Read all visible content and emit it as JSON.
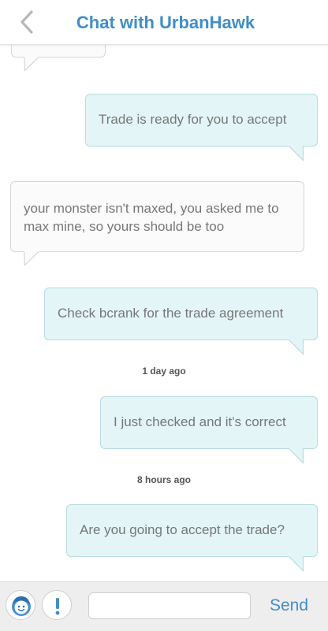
{
  "header": {
    "title": "Chat with UrbanHawk",
    "back_icon": "chevron-left-icon"
  },
  "messages": [
    {
      "kind": "bubble",
      "direction": "incoming",
      "text": ""
    },
    {
      "kind": "bubble",
      "direction": "outgoing",
      "text": "Trade is ready for you to accept"
    },
    {
      "kind": "bubble",
      "direction": "incoming",
      "text": "your monster isn't maxed, you asked me to max mine, so yours should be too"
    },
    {
      "kind": "bubble",
      "direction": "outgoing",
      "text": "Check bcrank for the trade agreement"
    },
    {
      "kind": "timestamp",
      "text": "1 day ago"
    },
    {
      "kind": "bubble",
      "direction": "outgoing",
      "text": "I just checked and it's correct"
    },
    {
      "kind": "timestamp",
      "text": "8 hours ago"
    },
    {
      "kind": "bubble",
      "direction": "outgoing",
      "text": "Are you going to accept the trade?"
    }
  ],
  "composer": {
    "avatar_icon": "smiley-face-icon",
    "report_icon": "exclamation-icon",
    "input_value": "",
    "input_placeholder": "",
    "send_label": "Send"
  },
  "colors": {
    "accent": "#3f8ec9",
    "outgoing_bubble": "#e3f5f7",
    "outgoing_border": "#b7dde3",
    "incoming_bubble": "#fbfbfb",
    "incoming_border": "#d6d6d6",
    "message_text": "#777777"
  }
}
